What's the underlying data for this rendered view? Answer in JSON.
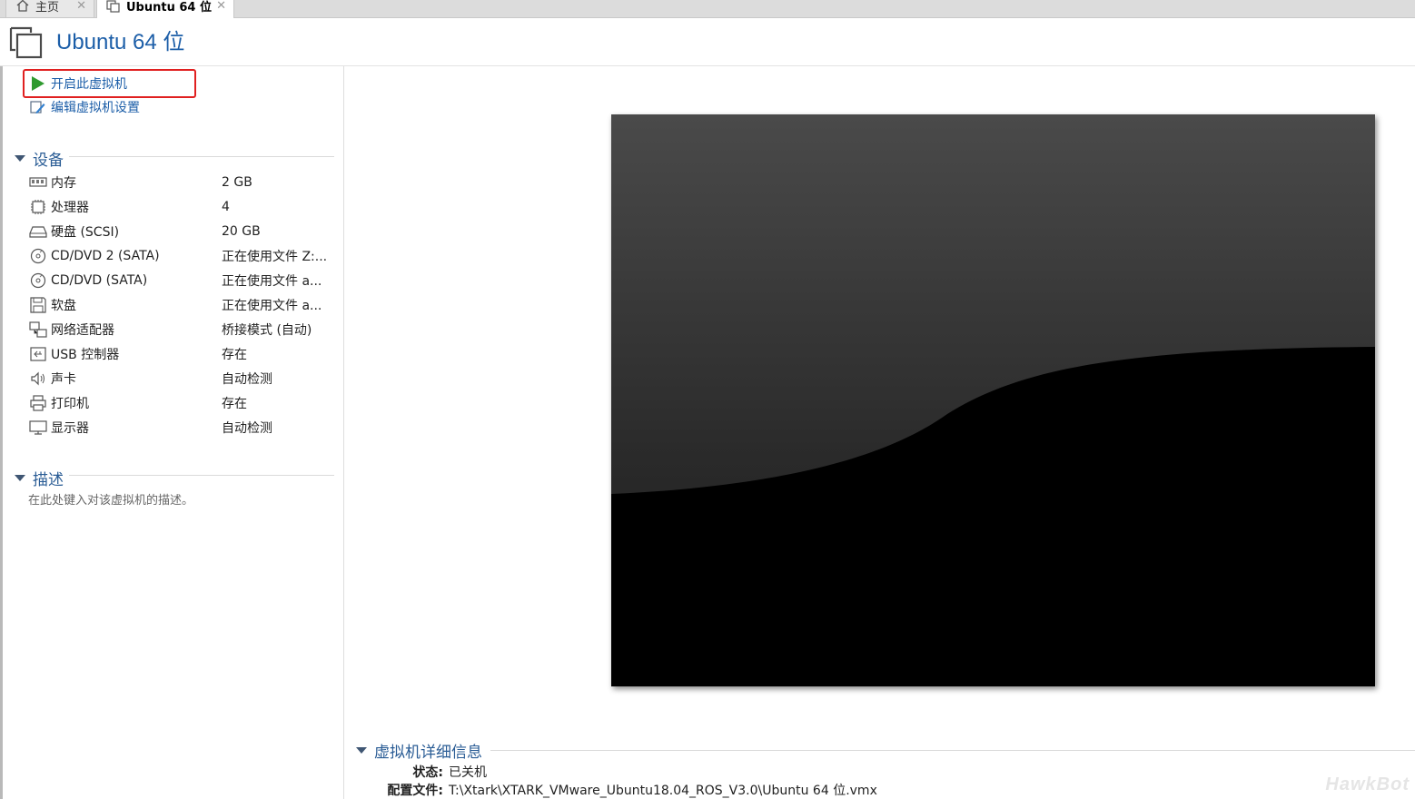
{
  "tabs": [
    {
      "label": "主页",
      "icon": "home-icon"
    },
    {
      "label": "Ubuntu 64 位",
      "icon": "vm-tab-icon"
    }
  ],
  "header": {
    "title": "Ubuntu 64 位",
    "icon": "virtual-machine-icon"
  },
  "actions": {
    "power_on": "开启此虚拟机",
    "edit_settings": "编辑虚拟机设置"
  },
  "devices": {
    "heading": "设备",
    "items": [
      {
        "name": "内存",
        "value": "2 GB",
        "icon": "memory-icon"
      },
      {
        "name": "处理器",
        "value": "4",
        "icon": "processor-icon"
      },
      {
        "name": "硬盘 (SCSI)",
        "value": "20 GB",
        "icon": "hard-disk-icon"
      },
      {
        "name": "CD/DVD 2 (SATA)",
        "value": "正在使用文件 Z:...",
        "icon": "cd-dvd-icon"
      },
      {
        "name": "CD/DVD (SATA)",
        "value": "正在使用文件 a...",
        "icon": "cd-dvd-icon"
      },
      {
        "name": "软盘",
        "value": "正在使用文件 a...",
        "icon": "floppy-icon"
      },
      {
        "name": "网络适配器",
        "value": "桥接模式 (自动)",
        "icon": "network-adapter-icon"
      },
      {
        "name": "USB 控制器",
        "value": "存在",
        "icon": "usb-controller-icon"
      },
      {
        "name": "声卡",
        "value": "自动检测",
        "icon": "sound-card-icon"
      },
      {
        "name": "打印机",
        "value": "存在",
        "icon": "printer-icon"
      },
      {
        "name": "显示器",
        "value": "自动检测",
        "icon": "display-icon"
      }
    ]
  },
  "description": {
    "heading": "描述",
    "placeholder": "在此处键入对该虚拟机的描述。"
  },
  "details": {
    "heading": "虚拟机详细信息",
    "status_label": "状态:",
    "status_value": "已关机",
    "config_label": "配置文件:",
    "config_value": "T:\\Xtark\\XTARK_VMware_Ubuntu18.04_ROS_V3.0\\Ubuntu 64 位.vmx"
  },
  "watermark": "HawkBot",
  "colors": {
    "accent": "#1c5ea8",
    "highlight": "#e02020",
    "play": "#2f9a2f"
  }
}
